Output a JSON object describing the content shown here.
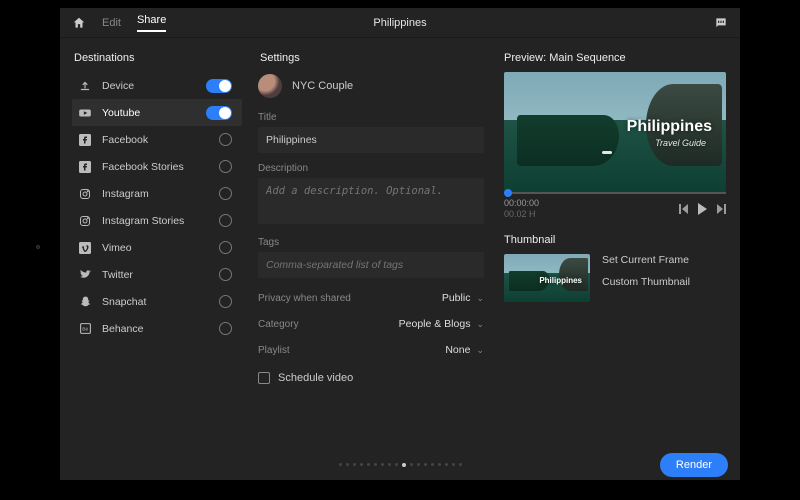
{
  "topbar": {
    "tabs": {
      "edit": "Edit",
      "share": "Share"
    },
    "active_tab": "share",
    "project_title": "Philippines"
  },
  "sidebar": {
    "header": "Destinations",
    "items": [
      {
        "icon": "upload-icon",
        "label": "Device",
        "state": "on"
      },
      {
        "icon": "youtube-icon",
        "label": "Youtube",
        "state": "on",
        "selected": true
      },
      {
        "icon": "facebook-icon",
        "label": "Facebook",
        "state": "off"
      },
      {
        "icon": "facebook-icon",
        "label": "Facebook Stories",
        "state": "off"
      },
      {
        "icon": "instagram-icon",
        "label": "Instagram",
        "state": "off"
      },
      {
        "icon": "instagram-icon",
        "label": "Instagram Stories",
        "state": "off"
      },
      {
        "icon": "vimeo-icon",
        "label": "Vimeo",
        "state": "off"
      },
      {
        "icon": "twitter-icon",
        "label": "Twitter",
        "state": "off"
      },
      {
        "icon": "snapchat-icon",
        "label": "Snapchat",
        "state": "off"
      },
      {
        "icon": "behance-icon",
        "label": "Behance",
        "state": "off"
      }
    ]
  },
  "settings": {
    "header": "Settings",
    "account_name": "NYC Couple",
    "labels": {
      "title": "Title",
      "description": "Description",
      "tags": "Tags",
      "privacy": "Privacy when shared",
      "category": "Category",
      "playlist": "Playlist",
      "schedule": "Schedule video"
    },
    "title_value": "Philippines",
    "description_placeholder": "Add a description. Optional.",
    "tags_placeholder": "Comma-separated list of tags",
    "privacy_value": "Public",
    "category_value": "People & Blogs",
    "playlist_value": "None",
    "schedule_checked": false
  },
  "preview": {
    "header": "Preview: Main Sequence",
    "overlay_title": "Philippines",
    "overlay_sub": "Travel Guide",
    "time_current": "00:00:00",
    "time_fine": "00.02 H",
    "thumbnail_header": "Thumbnail",
    "actions": {
      "set_frame": "Set Current Frame",
      "custom": "Custom Thumbnail"
    }
  },
  "footer": {
    "render_label": "Render"
  }
}
